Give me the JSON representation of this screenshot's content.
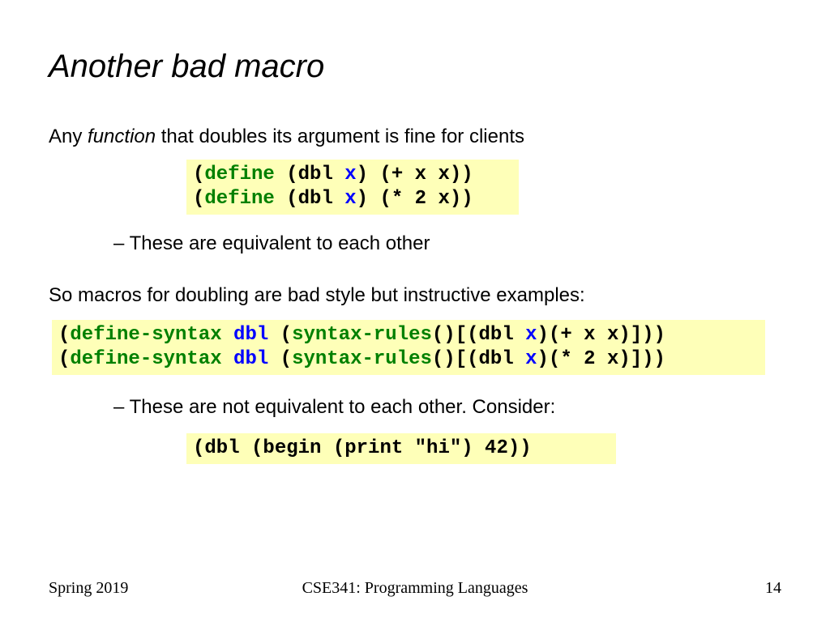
{
  "title": "Another bad macro",
  "intro_prefix": "Any ",
  "intro_fn": "function",
  "intro_suffix": " that doubles its argument is fine for clients",
  "bullet1": "–  These are equivalent to each other",
  "para2": "So macros for doubling are bad style but instructive examples:",
  "bullet2": "–  These are not equivalent to each other.  Consider:",
  "code1": {
    "l1a": "(",
    "l1b": "define",
    "l1c": " (dbl ",
    "l1d": "x",
    "l1e": ") (+ x x))",
    "l2a": "(",
    "l2b": "define",
    "l2c": " (dbl ",
    "l2d": "x",
    "l2e": ") (* 2 x))"
  },
  "code2": {
    "l1a": "(",
    "l1b": "define-syntax",
    "l1c": " ",
    "l1d": "dbl",
    "l1e": " (",
    "l1f": "syntax-rules",
    "l1g": "()[(dbl ",
    "l1h": "x",
    "l1i": ")(+ x x)]))",
    "l2a": "(",
    "l2b": "define-syntax",
    "l2c": " ",
    "l2d": "dbl",
    "l2e": " (",
    "l2f": "syntax-rules",
    "l2g": "()[(dbl ",
    "l2h": "x",
    "l2i": ")(* 2 x)]))"
  },
  "code3": {
    "l1": "(dbl (begin (print \"hi\") 42))"
  },
  "footer": {
    "left": "Spring 2019",
    "center": "CSE341: Programming Languages",
    "right": "14"
  }
}
